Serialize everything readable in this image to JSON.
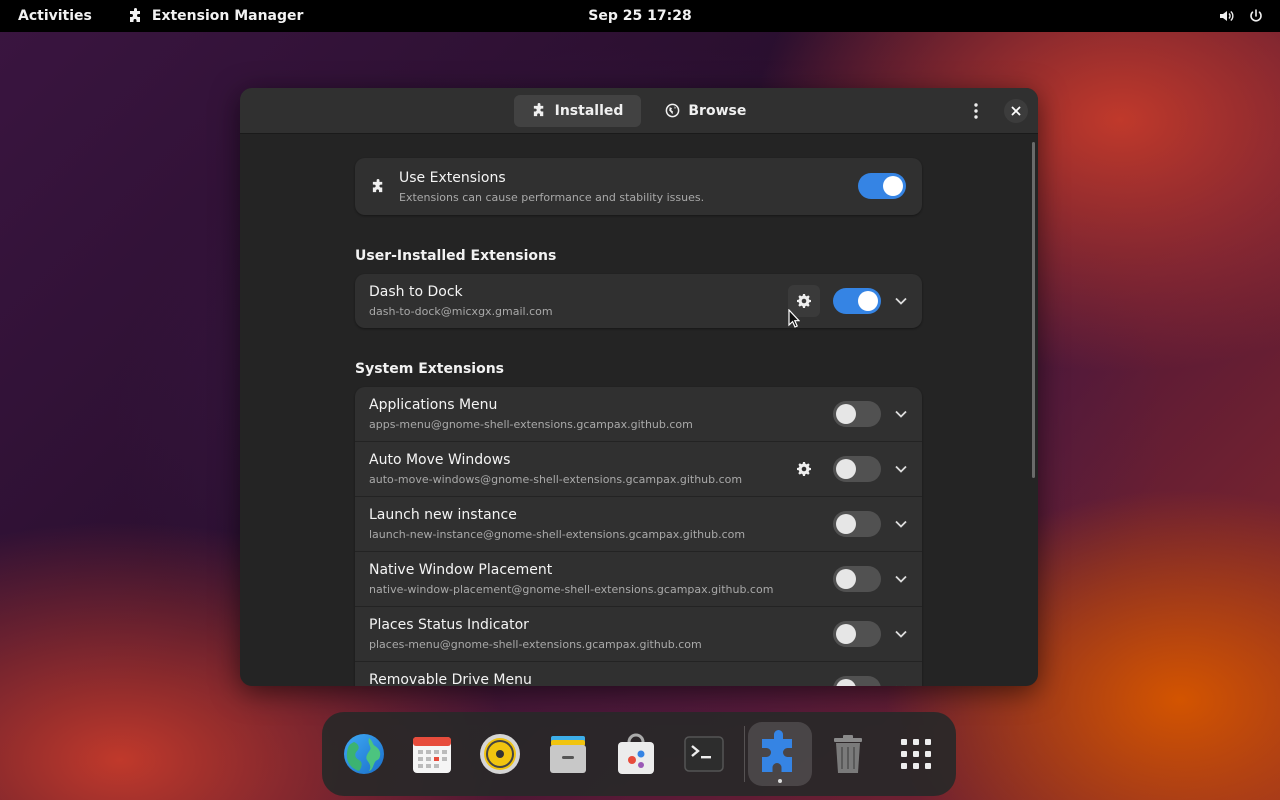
{
  "topbar": {
    "activities": "Activities",
    "app_name": "Extension Manager",
    "clock": "Sep 25  17:28",
    "icons": [
      "volume-icon",
      "power-icon"
    ]
  },
  "window": {
    "tabs": [
      {
        "label": "Installed",
        "icon": "puzzle-icon",
        "active": true
      },
      {
        "label": "Browse",
        "icon": "globe-icon",
        "active": false
      }
    ],
    "use_extensions": {
      "title": "Use Extensions",
      "subtitle": "Extensions can cause performance and stability issues.",
      "enabled": true
    },
    "user_section_title": "User-Installed Extensions",
    "user_extensions": [
      {
        "name": "Dash to Dock",
        "id": "dash-to-dock@micxgx.gmail.com",
        "enabled": true,
        "has_settings": true
      }
    ],
    "system_section_title": "System Extensions",
    "system_extensions": [
      {
        "name": "Applications Menu",
        "id": "apps-menu@gnome-shell-extensions.gcampax.github.com",
        "enabled": false,
        "has_settings": false
      },
      {
        "name": "Auto Move Windows",
        "id": "auto-move-windows@gnome-shell-extensions.gcampax.github.com",
        "enabled": false,
        "has_settings": true
      },
      {
        "name": "Launch new instance",
        "id": "launch-new-instance@gnome-shell-extensions.gcampax.github.com",
        "enabled": false,
        "has_settings": false
      },
      {
        "name": "Native Window Placement",
        "id": "native-window-placement@gnome-shell-extensions.gcampax.github.com",
        "enabled": false,
        "has_settings": false
      },
      {
        "name": "Places Status Indicator",
        "id": "places-menu@gnome-shell-extensions.gcampax.github.com",
        "enabled": false,
        "has_settings": false
      },
      {
        "name": "Removable Drive Menu",
        "id": "",
        "enabled": false,
        "has_settings": false
      }
    ]
  },
  "dock": {
    "apps": [
      {
        "name": "web-browser-icon",
        "active": false
      },
      {
        "name": "calendar-icon",
        "active": false
      },
      {
        "name": "music-player-icon",
        "active": false
      },
      {
        "name": "files-icon",
        "active": false
      },
      {
        "name": "software-store-icon",
        "active": false
      },
      {
        "name": "terminal-icon",
        "active": false
      },
      {
        "name": "extension-manager-icon",
        "active": true
      },
      {
        "name": "trash-icon",
        "active": false
      },
      {
        "name": "app-grid-icon",
        "active": false
      }
    ]
  },
  "colors": {
    "accent": "#3584e4",
    "window_bg": "#242424",
    "card_bg": "#303030"
  }
}
